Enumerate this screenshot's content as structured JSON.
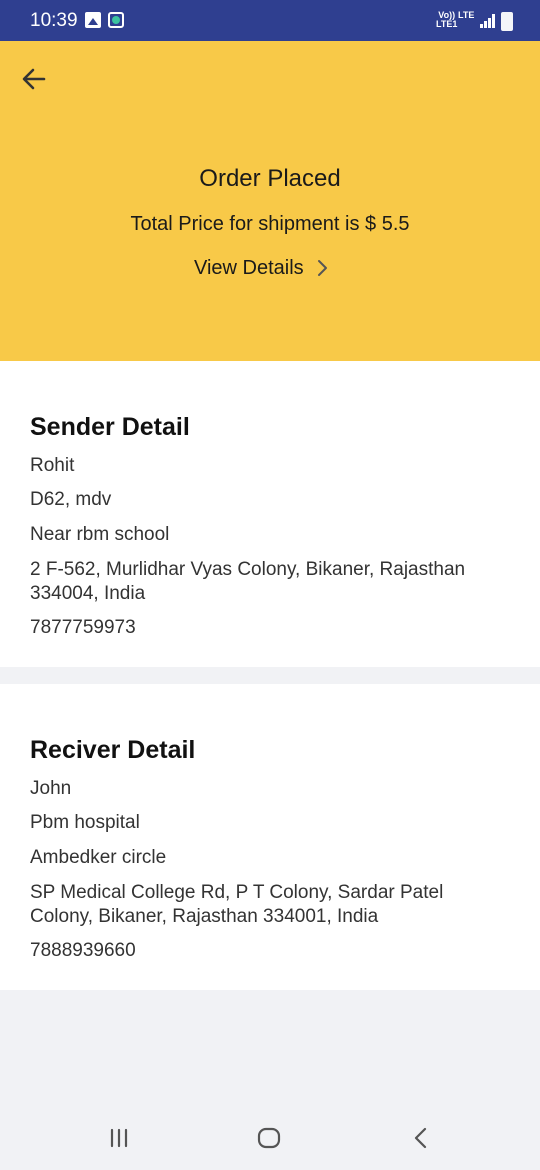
{
  "status_bar": {
    "time": "10:39",
    "network_label_top": "Vo))",
    "network_label_bottom": "LTE1",
    "lte_label": "LTE"
  },
  "header": {
    "title": "Order Placed",
    "price_text": "Total Price for shipment is $ 5.5",
    "view_details_label": "View Details",
    "background_color": "#f8c948"
  },
  "sender": {
    "heading": "Sender Detail",
    "name": "Rohit",
    "address_line1": "D62, mdv",
    "landmark": "Near rbm school",
    "address_full": "2 F-562, Murlidhar Vyas Colony, Bikaner, Rajasthan 334004, India",
    "phone": "7877759973"
  },
  "receiver": {
    "heading": "Reciver Detail",
    "name": "John",
    "address_line1": "Pbm hospital",
    "landmark": "Ambedker circle",
    "address_full": "SP Medical College Rd, P T Colony, Sardar Patel Colony, Bikaner, Rajasthan 334001, India",
    "phone": "7888939660"
  },
  "icons": {
    "back": "arrow-left-icon",
    "view_details": "chevron-right-icon",
    "nav_recents": "recents-icon",
    "nav_home": "home-icon",
    "nav_back": "back-icon"
  }
}
